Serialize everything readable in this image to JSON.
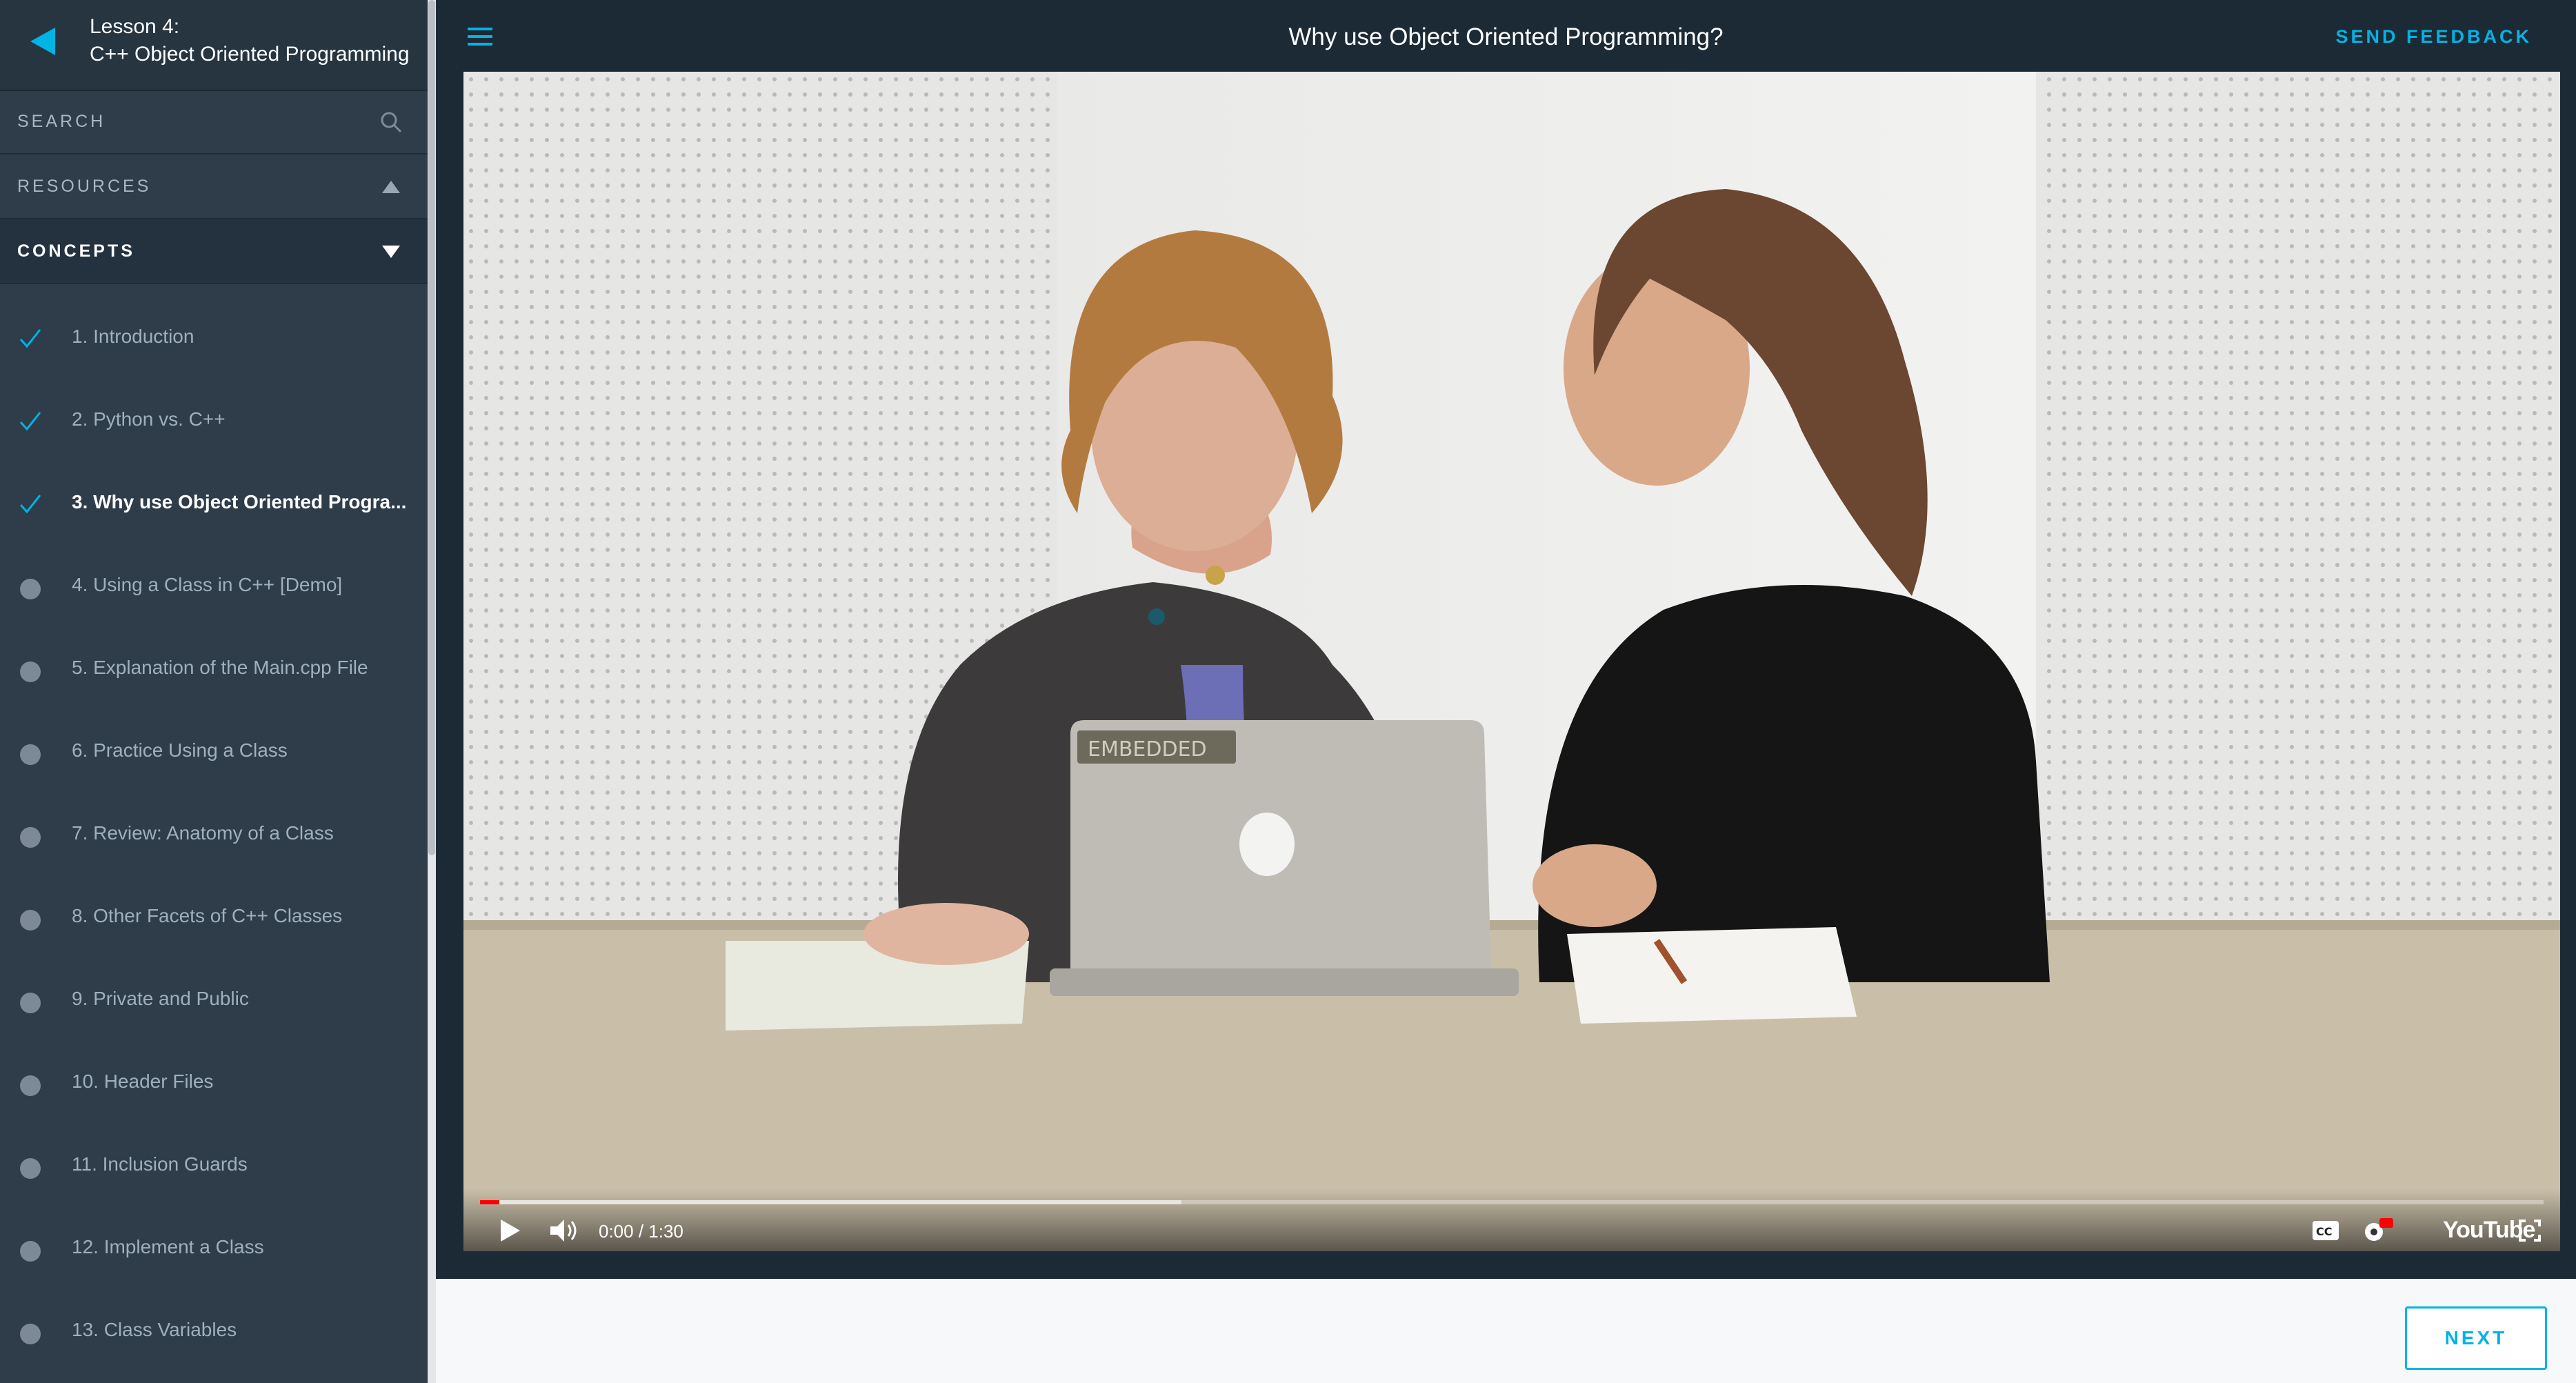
{
  "sidebar": {
    "lesson_number": "Lesson 4:",
    "lesson_title": "C++ Object Oriented Programming",
    "search_label": "SEARCH",
    "resources_label": "RESOURCES",
    "concepts_label": "CONCEPTS",
    "concepts": [
      {
        "title": "1. Introduction",
        "status": "completed"
      },
      {
        "title": "2. Python vs. C++",
        "status": "completed"
      },
      {
        "title": "3. Why use Object Oriented Progra...",
        "status": "completed-current"
      },
      {
        "title": "4. Using a Class in C++ [Demo]",
        "status": "not-started"
      },
      {
        "title": "5. Explanation of the Main.cpp File",
        "status": "not-started"
      },
      {
        "title": "6. Practice Using a Class",
        "status": "not-started"
      },
      {
        "title": "7. Review: Anatomy of a Class",
        "status": "not-started"
      },
      {
        "title": "8. Other Facets of C++ Classes",
        "status": "not-started"
      },
      {
        "title": "9. Private and Public",
        "status": "not-started"
      },
      {
        "title": "10. Header Files",
        "status": "not-started"
      },
      {
        "title": "11. Inclusion Guards",
        "status": "not-started"
      },
      {
        "title": "12. Implement a Class",
        "status": "not-started"
      },
      {
        "title": "13. Class Variables",
        "status": "not-started"
      }
    ]
  },
  "header": {
    "title": "Why use Object Oriented Programming?",
    "feedback_label": "SEND FEEDBACK"
  },
  "video": {
    "time": "0:00 / 1:30",
    "brand": "YouTube",
    "laptop_sticker": "EMBEDDED",
    "played_fraction": 0.0,
    "buffered_fraction": 0.34
  },
  "footer": {
    "next_label": "NEXT"
  },
  "colors": {
    "accent": "#02b3e4",
    "sidebar_bg": "#2e3d49",
    "topbar_bg": "#1c2a35"
  }
}
